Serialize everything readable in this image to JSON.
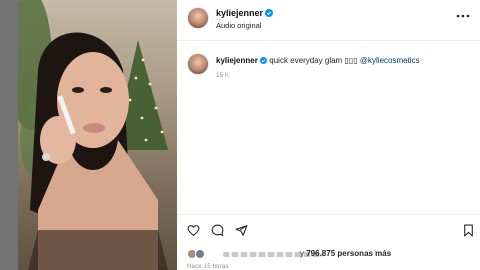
{
  "post": {
    "username": "kyliejenner",
    "audio": "Audio original",
    "caption_username": "kyliejenner",
    "caption_text": "quick everyday glam",
    "caption_emoji": "▯▯▯",
    "caption_mention": "@kyliecosmetics",
    "caption_time": "15 h",
    "likes_prefix": "y",
    "likes_count": "796.875",
    "likes_suffix": "personas más",
    "posted_ago": "Hace 15 horas"
  },
  "icons": {
    "more": "more-horizontal-icon",
    "like": "heart-icon",
    "comment": "comment-icon",
    "share": "share-icon",
    "save": "bookmark-icon",
    "verified": "verified-badge-icon"
  },
  "colors": {
    "verified": "#0095f6",
    "mention": "#00376b",
    "muted": "#8e8e8e",
    "text": "#262626"
  }
}
